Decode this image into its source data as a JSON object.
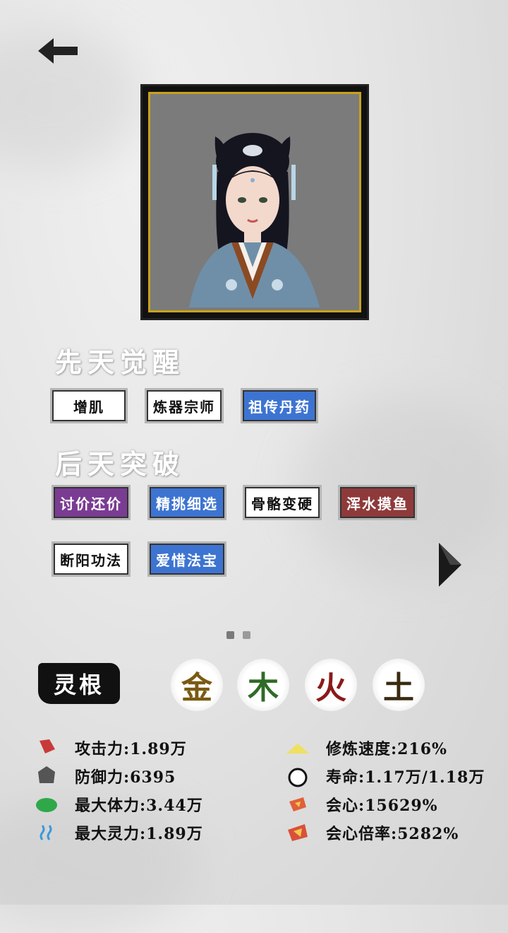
{
  "innate": {
    "title": "先天觉醒",
    "traits": [
      {
        "label": "增肌",
        "rarity": "white"
      },
      {
        "label": "炼器宗师",
        "rarity": "white"
      },
      {
        "label": "祖传丹药",
        "rarity": "blue"
      }
    ]
  },
  "acquired": {
    "title": "后天突破",
    "traits": [
      {
        "label": "讨价还价",
        "rarity": "purple"
      },
      {
        "label": "精挑细选",
        "rarity": "blue"
      },
      {
        "label": "骨骼变硬",
        "rarity": "white"
      },
      {
        "label": "浑水摸鱼",
        "rarity": "red"
      },
      {
        "label": "断阳功法",
        "rarity": "white"
      },
      {
        "label": "爱惜法宝",
        "rarity": "blue"
      }
    ]
  },
  "pagination": {
    "pages": 2,
    "current": 1
  },
  "linggen": {
    "label": "灵根",
    "elements": [
      {
        "char": "金",
        "color": "#7a5a12"
      },
      {
        "char": "木",
        "color": "#2f6b26"
      },
      {
        "char": "火",
        "color": "#8b1a1a"
      },
      {
        "char": "土",
        "color": "#3a2a10"
      }
    ]
  },
  "stats_left": [
    {
      "icon": "attack-icon",
      "text": "攻击力:1.89万"
    },
    {
      "icon": "defense-icon",
      "text": "防御力:6395"
    },
    {
      "icon": "health-icon",
      "text": "最大体力:3.44万"
    },
    {
      "icon": "spirit-icon",
      "text": "最大灵力:1.89万"
    }
  ],
  "stats_right": [
    {
      "icon": "cultivation-speed-icon",
      "text": "修炼速度:216%"
    },
    {
      "icon": "lifespan-icon",
      "text": "寿命:1.17万/1.18万"
    },
    {
      "icon": "crit-icon",
      "text": "会心:15629%"
    },
    {
      "icon": "crit-multiplier-icon",
      "text": "会心倍率:5282%"
    }
  ],
  "colors": {
    "white_trait": "#ffffff",
    "blue_trait": "#3d74d1",
    "purple_trait": "#7a3c93",
    "red_trait": "#8e3a3a",
    "frame_gold": "#c9a21c"
  }
}
